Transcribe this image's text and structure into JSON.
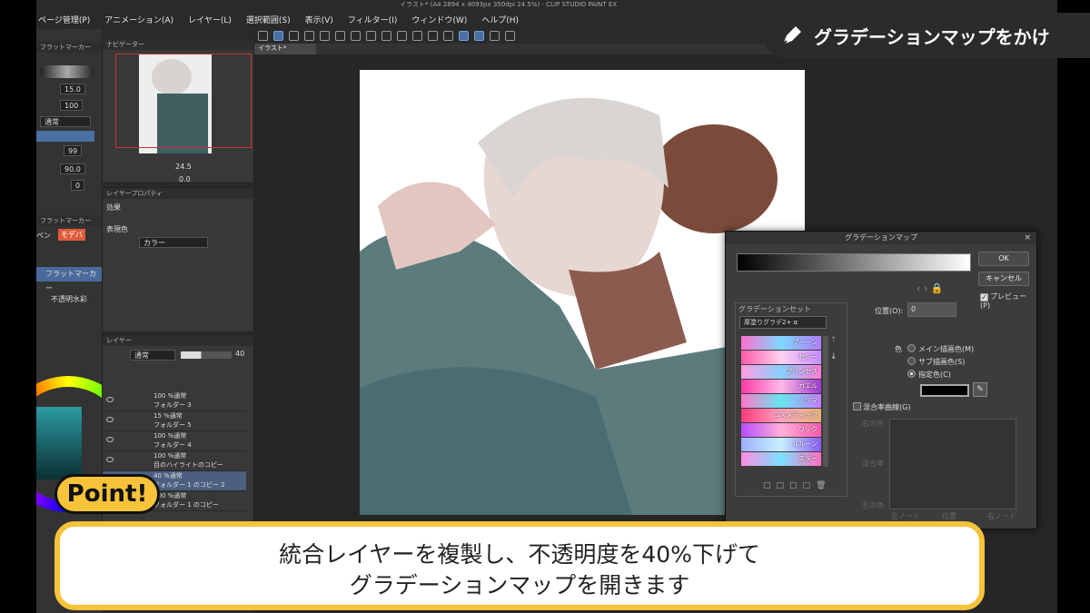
{
  "app": {
    "menu": [
      "ページ管理(P)",
      "アニメーション(A)",
      "レイヤー(L)",
      "選択範囲(S)",
      "表示(V)",
      "フィルター(I)",
      "ウィンドウ(W)",
      "ヘルプ(H)"
    ],
    "title_bar": "イラスト* (A4 2894 x 4093px 350dpi 24.5%) - CLIP STUDIO PAINT EX",
    "doc_tab": "イラスト*"
  },
  "left_panel": {
    "brush_tab": "フラットマーカー",
    "size_value": "15.0",
    "opacity_value": "100",
    "blend_mode": "通常",
    "value_99": "99",
    "value_90": "90.0",
    "value_0": "0",
    "sub_tab": "フラットマーカー",
    "pen_label": "ペン",
    "modebrush_label": "モデバ",
    "tool_item": "フラットマーカー",
    "tool_item2": "不透明水彩"
  },
  "navigator": {
    "tab": "ナビゲーター",
    "zoom": "24.5",
    "rotate": "0.0"
  },
  "layer_property": {
    "tab": "レイヤープロパティ",
    "effect_label": "効果",
    "expression_label": "表現色",
    "expression_value": "カラー"
  },
  "layers": {
    "tab": "レイヤー",
    "blend": "通常",
    "opacity": "40",
    "items": [
      {
        "mode": "100 %通常",
        "name": "フォルダー 3"
      },
      {
        "mode": "15 %通常",
        "name": "フォルダー 5"
      },
      {
        "mode": "100 %通常",
        "name": "フォルダー 4"
      },
      {
        "mode": "100 %通常",
        "name": "目のハイライトのコピー"
      },
      {
        "mode": "40 %通常",
        "name": "フォルダー 1 のコピー 2"
      },
      {
        "mode": "100 %通常",
        "name": "フォルダー 1 のコピー"
      }
    ]
  },
  "dialog": {
    "title": "グラデーションマップ",
    "ok": "OK",
    "cancel": "キャンセル",
    "preview": "プレビュー(P)",
    "set_label": "グラデーションセット",
    "set_value": "厚塗りグラデ2+ α",
    "presets": [
      "ブーーン",
      "セシー",
      "プリンセス",
      "ガエル",
      "ノリマ",
      "コスメティック",
      "ワック",
      "ルルーン",
      "スター"
    ],
    "position_label": "位置(O):",
    "position_value": "0",
    "color_label": "色",
    "color_options": [
      "メイン描画色(M)",
      "サブ描画色(S)",
      "指定色(C)"
    ],
    "mix_curve": "混合率曲線(G)",
    "axis_right": "右の色",
    "axis_mix": "混合率",
    "axis_left": "左の色",
    "node_left": "左ノード",
    "node_pos": "位置",
    "node_right": "右ノード",
    "specified_color": "#000000"
  },
  "overlay": {
    "header": "グラデーションマップをかけ",
    "point": "Point!",
    "caption_line1": "統合レイヤーを複製し、不透明度を40%下げて",
    "caption_line2": "グラデーションマップを開きます"
  },
  "colors": {
    "accent_yellow": "#f6c33a",
    "dialog_bg": "#3c3c3c",
    "selected_layer": "#4b5f80"
  }
}
